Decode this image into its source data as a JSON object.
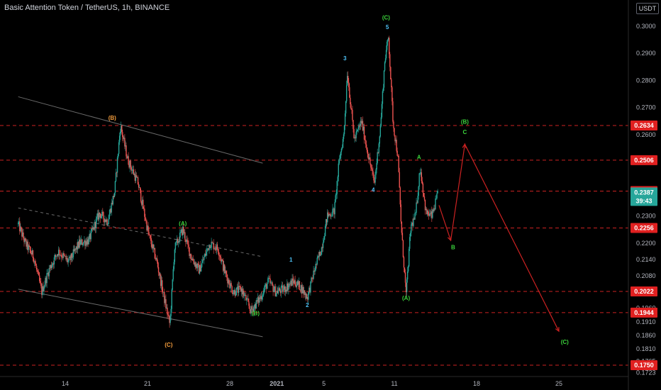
{
  "header": {
    "title": "Basic Attention Token / TetherUS, 1h, BINANCE",
    "currency_badge": "USDT"
  },
  "colors": {
    "background": "#000000",
    "candle_up": "#26a69a",
    "candle_down": "#ef5350",
    "hline": "#cc2222",
    "projection": "#cc2222",
    "channel": "#6b6b6b",
    "tag_red": "#e02020",
    "tag_teal": "#26a69a",
    "wave_green": "#3bd33b",
    "wave_orange": "#f39c3c",
    "wave_cyan": "#4fc3f7"
  },
  "chart_data": {
    "type": "candlestick",
    "ylim": [
      0.1723,
      0.3035
    ],
    "y_ticks": [
      "0.3000",
      "0.2900",
      "0.2800",
      "0.2700",
      "0.2600",
      "0.2500",
      "0.2400",
      "0.2300",
      "0.2200",
      "0.2140",
      "0.2080",
      "0.2020",
      "0.1960",
      "0.1910",
      "0.1860",
      "0.1810",
      "0.1765",
      "0.1723"
    ],
    "x_day_range": [
      10,
      28.5
    ],
    "x_ticks": [
      {
        "label": "14",
        "day": 14
      },
      {
        "label": "21",
        "day": 21
      },
      {
        "label": "28",
        "day": 28
      },
      {
        "label": "2021",
        "day": 32
      },
      {
        "label": "5",
        "day": 36
      },
      {
        "label": "11",
        "day": 42
      },
      {
        "label": "18",
        "day": 49
      },
      {
        "label": "25",
        "day": 56
      }
    ],
    "horizontal_levels": [
      "0.2634",
      "0.2506",
      "0.2392",
      "0.2256",
      "0.2022",
      "0.1944",
      "0.1750"
    ],
    "last_price": {
      "value": "0.2387",
      "countdown": "39:43"
    },
    "price_path": [
      [
        10.0,
        0.227
      ],
      [
        10.6,
        0.22
      ],
      [
        11.3,
        0.215
      ],
      [
        12.0,
        0.202
      ],
      [
        12.6,
        0.21
      ],
      [
        13.4,
        0.217
      ],
      [
        14.3,
        0.213
      ],
      [
        15.2,
        0.22
      ],
      [
        16.0,
        0.221
      ],
      [
        16.9,
        0.231
      ],
      [
        17.6,
        0.228
      ],
      [
        18.2,
        0.239
      ],
      [
        18.7,
        0.2634
      ],
      [
        19.3,
        0.251
      ],
      [
        20.2,
        0.242
      ],
      [
        21.1,
        0.223
      ],
      [
        21.8,
        0.213
      ],
      [
        22.4,
        0.2
      ],
      [
        22.9,
        0.19
      ],
      [
        23.3,
        0.218
      ],
      [
        24.0,
        0.225
      ],
      [
        24.7,
        0.215
      ],
      [
        25.4,
        0.21
      ],
      [
        26.3,
        0.22
      ],
      [
        27.0,
        0.218
      ],
      [
        27.6,
        0.209
      ],
      [
        28.3,
        0.202
      ],
      [
        29.0,
        0.203
      ],
      [
        29.8,
        0.195
      ],
      [
        30.6,
        0.2
      ],
      [
        31.3,
        0.206
      ],
      [
        31.9,
        0.202
      ],
      [
        32.6,
        0.203
      ],
      [
        33.4,
        0.206
      ],
      [
        34.0,
        0.204
      ],
      [
        34.6,
        0.2
      ],
      [
        35.2,
        0.21
      ],
      [
        35.8,
        0.218
      ],
      [
        36.3,
        0.23
      ],
      [
        36.9,
        0.232
      ],
      [
        37.3,
        0.25
      ],
      [
        37.7,
        0.26
      ],
      [
        38.0,
        0.283
      ],
      [
        38.6,
        0.258
      ],
      [
        39.2,
        0.265
      ],
      [
        39.8,
        0.252
      ],
      [
        40.3,
        0.242
      ],
      [
        40.8,
        0.262
      ],
      [
        41.2,
        0.288
      ],
      [
        41.5,
        0.296
      ],
      [
        41.9,
        0.264
      ],
      [
        42.3,
        0.252
      ],
      [
        42.6,
        0.225
      ],
      [
        43.0,
        0.201
      ],
      [
        43.4,
        0.226
      ],
      [
        43.8,
        0.23
      ],
      [
        44.2,
        0.248
      ],
      [
        44.7,
        0.231
      ],
      [
        45.2,
        0.23
      ],
      [
        45.7,
        0.238
      ]
    ],
    "wave_labels": [
      {
        "text": "(B)",
        "day": 18.0,
        "price": 0.2655,
        "color": "wave_orange"
      },
      {
        "text": "(C)",
        "day": 22.8,
        "price": 0.1818,
        "color": "wave_orange"
      },
      {
        "text": "(A)",
        "day": 24.0,
        "price": 0.2265,
        "color": "wave_green"
      },
      {
        "text": "(B)",
        "day": 30.2,
        "price": 0.1935,
        "color": "wave_green"
      },
      {
        "text": "1",
        "day": 33.2,
        "price": 0.2132,
        "color": "wave_cyan"
      },
      {
        "text": "2",
        "day": 34.6,
        "price": 0.1965,
        "color": "wave_cyan"
      },
      {
        "text": "3",
        "day": 37.8,
        "price": 0.2875,
        "color": "wave_cyan"
      },
      {
        "text": "4",
        "day": 40.2,
        "price": 0.239,
        "color": "wave_cyan"
      },
      {
        "text": "5",
        "day": 41.4,
        "price": 0.299,
        "color": "wave_cyan"
      },
      {
        "text": "(C)",
        "day": 41.3,
        "price": 0.3025,
        "color": "wave_green"
      },
      {
        "text": "(A)",
        "day": 43.0,
        "price": 0.199,
        "color": "wave_green"
      },
      {
        "text": "A",
        "day": 44.1,
        "price": 0.251,
        "color": "wave_green"
      },
      {
        "text": "B",
        "day": 47.0,
        "price": 0.2178,
        "color": "wave_green"
      },
      {
        "text": "(B)",
        "day": 48.0,
        "price": 0.264,
        "color": "wave_green"
      },
      {
        "text": "C",
        "day": 48.0,
        "price": 0.2602,
        "color": "wave_green"
      },
      {
        "text": "(C)",
        "day": 56.5,
        "price": 0.1828,
        "color": "wave_green"
      }
    ],
    "projection_path": [
      [
        45.8,
        0.234
      ],
      [
        46.8,
        0.221
      ],
      [
        48.0,
        0.2565
      ],
      [
        56.0,
        0.1875
      ]
    ],
    "channels": [
      {
        "style": "solid",
        "from": [
          10.0,
          0.274
        ],
        "to": [
          30.8,
          0.2495
        ]
      },
      {
        "style": "solid",
        "from": [
          10.0,
          0.203
        ],
        "to": [
          30.8,
          0.1855
        ]
      },
      {
        "style": "dashed",
        "from": [
          10.0,
          0.233
        ],
        "to": [
          30.8,
          0.215
        ]
      }
    ]
  }
}
